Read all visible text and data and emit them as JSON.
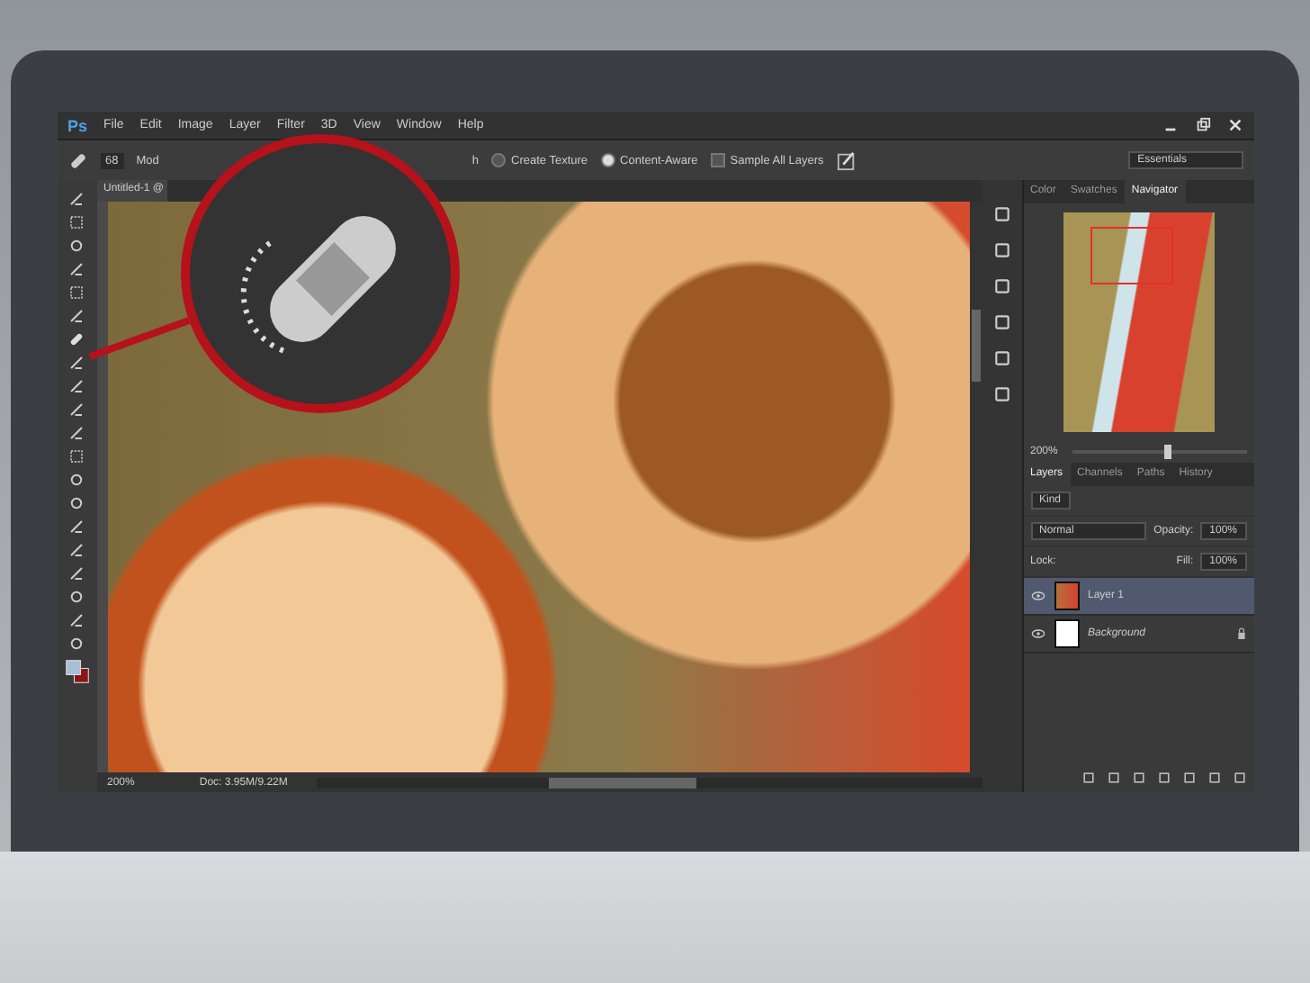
{
  "app": {
    "logo": "Ps",
    "menu": [
      "File",
      "Edit",
      "Image",
      "Layer",
      "Filter",
      "3D",
      "View",
      "Window",
      "Help"
    ]
  },
  "options": {
    "brush_size": "68",
    "mode_label": "Mod",
    "cut_label": "h",
    "choices": [
      {
        "kind": "radio",
        "label": "Create Texture",
        "checked": false
      },
      {
        "kind": "radio",
        "label": "Content-Aware",
        "checked": true
      },
      {
        "kind": "checkbox",
        "label": "Sample All Layers",
        "checked": false
      }
    ],
    "workspace": "Essentials"
  },
  "document": {
    "tab": "Untitled-1 @",
    "zoom": "200%",
    "doc_size": "Doc: 3.95M/9.22M"
  },
  "navigator": {
    "tabs": [
      {
        "label": "Color",
        "selected": false
      },
      {
        "label": "Swatches",
        "selected": false
      },
      {
        "label": "Navigator",
        "selected": true
      }
    ],
    "zoom": "200%",
    "level": 0.55
  },
  "layers_panel": {
    "tabs": [
      {
        "label": "Layers",
        "selected": true
      },
      {
        "label": "Channels",
        "selected": false
      },
      {
        "label": "Paths",
        "selected": false
      },
      {
        "label": "History",
        "selected": false
      }
    ],
    "filter": "Kind",
    "blend_mode": "Normal",
    "opacity_label": "Opacity:",
    "opacity": "100%",
    "lock_label": "Lock:",
    "fill_label": "Fill:",
    "fill": "100%",
    "layers": [
      {
        "name": "Layer 1",
        "selected": true,
        "visible": true,
        "locked": false,
        "kind": "image"
      },
      {
        "name": "Background",
        "selected": false,
        "visible": true,
        "locked": true,
        "kind": "white"
      }
    ]
  }
}
